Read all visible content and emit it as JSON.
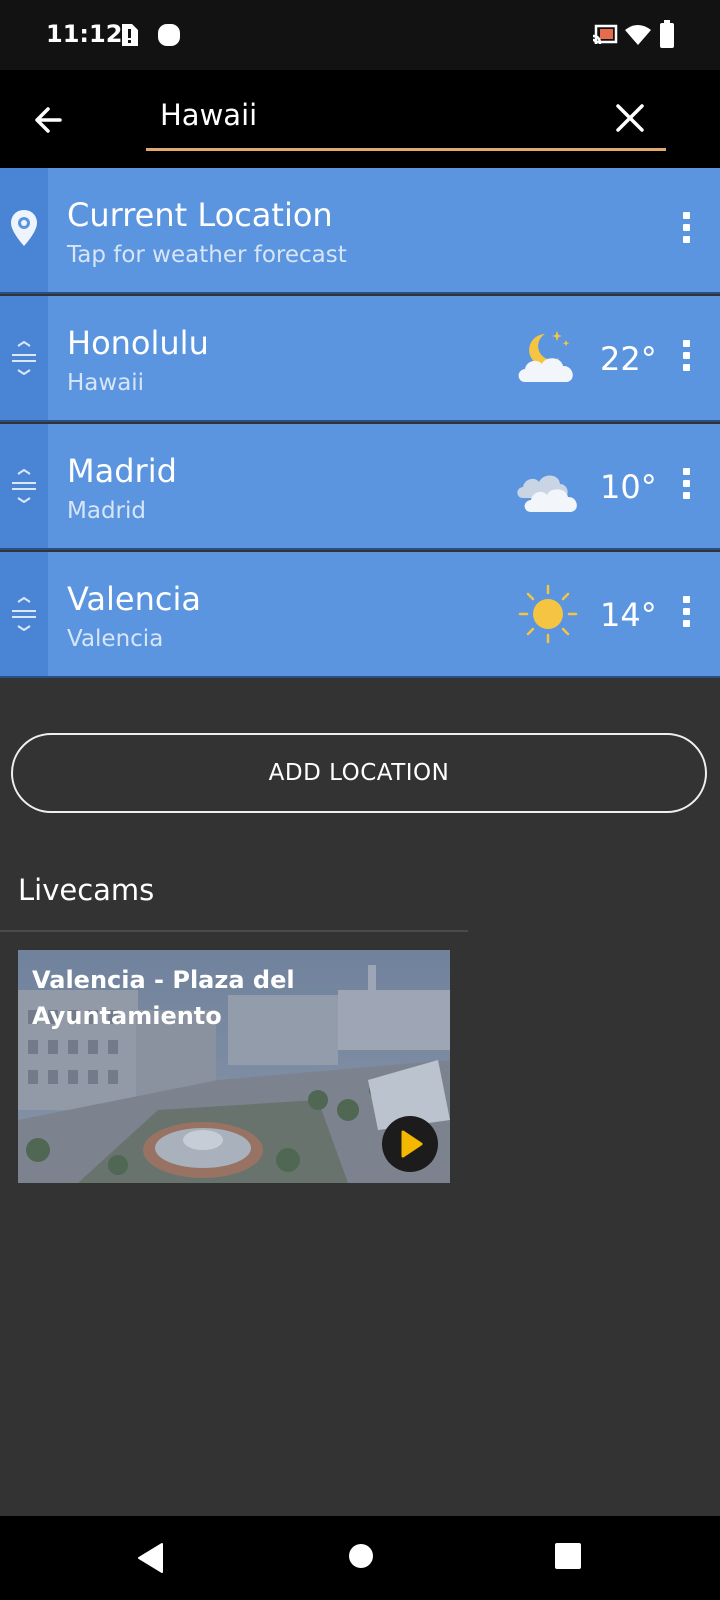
{
  "status_bar": {
    "time": "11:12",
    "icons": [
      "alert-notification-icon",
      "circle-notification-icon",
      "cast-icon",
      "wifi-icon",
      "battery-icon"
    ]
  },
  "search": {
    "value": "Hawaii",
    "underline_color": "#e0a96d"
  },
  "locations": [
    {
      "name": "Current Location",
      "subtitle": "Tap for weather forecast",
      "icon": "location-pin-icon"
    },
    {
      "name": "Honolulu",
      "subtitle": "Hawaii",
      "temperature": "22°",
      "weather_icon": "partly-cloudy-night-icon"
    },
    {
      "name": "Madrid",
      "subtitle": "Madrid",
      "temperature": "10°",
      "weather_icon": "cloudy-icon"
    },
    {
      "name": "Valencia",
      "subtitle": "Valencia",
      "temperature": "14°",
      "weather_icon": "sunny-icon"
    }
  ],
  "add_location_label": "ADD LOCATION",
  "livecams": {
    "title": "Livecams",
    "cams": [
      {
        "title": "Valencia - Plaza del Ayuntamiento",
        "play_icon": "play-icon"
      }
    ]
  },
  "colors": {
    "list_item_bg": "#5b95e0",
    "handle_bg": "#4a84d4",
    "page_bg": "#333333",
    "accent_play": "#f5b800"
  },
  "nav_bar": {
    "buttons": [
      "back-triangle-icon",
      "home-circle-icon",
      "recents-square-icon"
    ]
  }
}
